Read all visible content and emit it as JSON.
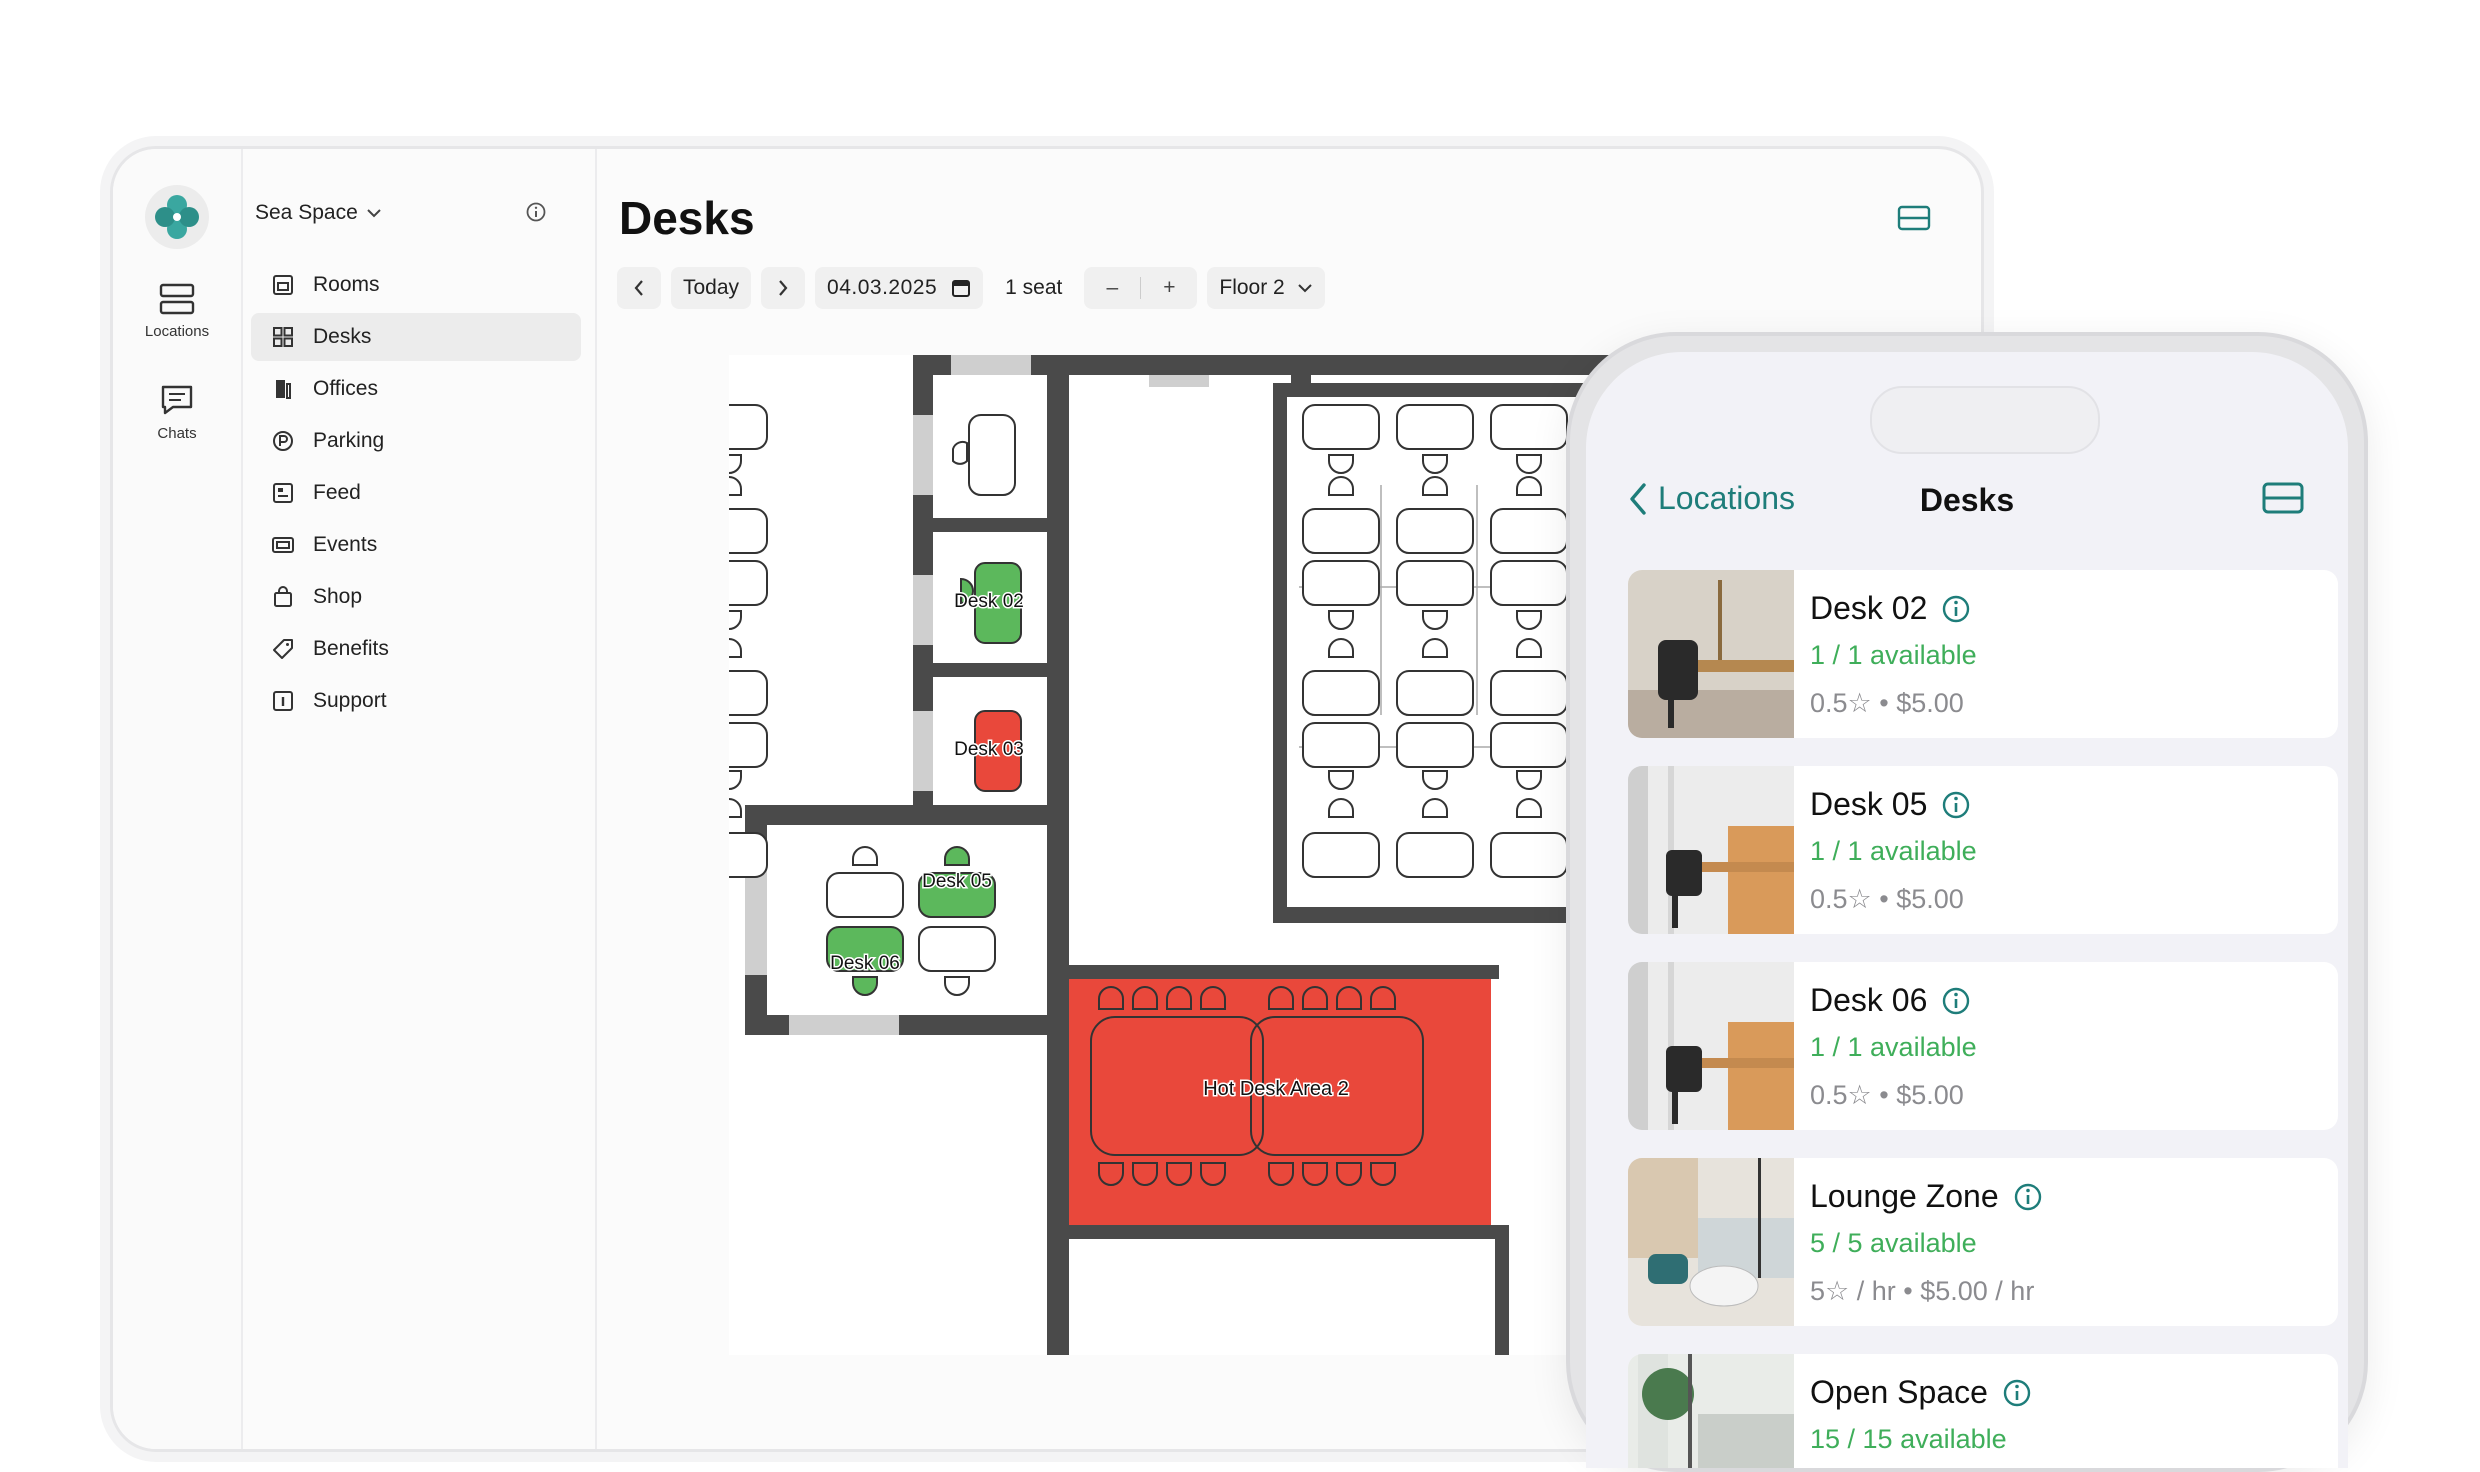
{
  "app": {
    "org_name": "Sea Space"
  },
  "rail": [
    {
      "label": "Locations",
      "icon": "locations-icon"
    },
    {
      "label": "Chats",
      "icon": "chats-icon"
    }
  ],
  "nav": [
    {
      "label": "Rooms",
      "icon": "rooms-icon",
      "active": false
    },
    {
      "label": "Desks",
      "icon": "desks-icon",
      "active": true
    },
    {
      "label": "Offices",
      "icon": "offices-icon",
      "active": false
    },
    {
      "label": "Parking",
      "icon": "parking-icon",
      "active": false
    },
    {
      "label": "Feed",
      "icon": "feed-icon",
      "active": false
    },
    {
      "label": "Events",
      "icon": "events-icon",
      "active": false
    },
    {
      "label": "Shop",
      "icon": "shop-icon",
      "active": false
    },
    {
      "label": "Benefits",
      "icon": "benefits-icon",
      "active": false
    },
    {
      "label": "Support",
      "icon": "support-icon",
      "active": false
    }
  ],
  "page": {
    "title": "Desks"
  },
  "toolbar": {
    "today": "Today",
    "date": "04.03.2025",
    "seat": "1 seat",
    "minus": "–",
    "plus": "+",
    "floor": "Floor 2"
  },
  "map": {
    "labels": {
      "desk02": "Desk 02",
      "desk03": "Desk 03",
      "desk05": "Desk 05",
      "desk06": "Desk 06",
      "hotdesk": "Hot Desk Area 2"
    }
  },
  "colors": {
    "accent": "#1e7d7a",
    "available": "#5cb85c",
    "booked": "#e9483b",
    "available_text": "#3fae5a"
  },
  "mobile": {
    "back_label": "Locations",
    "title": "Desks",
    "items": [
      {
        "name": "Desk 02",
        "availability": "1 / 1 available",
        "rating": "0.5",
        "price": "$5.00"
      },
      {
        "name": "Desk 05",
        "availability": "1 / 1 available",
        "rating": "0.5",
        "price": "$5.00"
      },
      {
        "name": "Desk 06",
        "availability": "1 / 1 available",
        "rating": "0.5",
        "price": "$5.00"
      },
      {
        "name": "Lounge Zone",
        "availability": "5 / 5 available",
        "rating": "5",
        "price": "/ hr • $5.00 / hr"
      },
      {
        "name": "Open Space",
        "availability": "15 / 15 available"
      }
    ]
  }
}
